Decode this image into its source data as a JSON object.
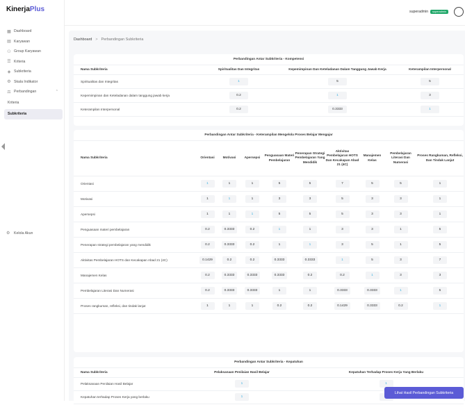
{
  "brand": {
    "name": "Kinerja",
    "accent": "Plus"
  },
  "sidebar": {
    "items": [
      {
        "label": "Dashboard",
        "icon": "grid-icon"
      },
      {
        "label": "Karyawan",
        "icon": "id-card-icon"
      },
      {
        "label": "Group Karyawan",
        "icon": "users-icon"
      },
      {
        "label": "Kriteria",
        "icon": "list-icon"
      },
      {
        "label": "Subkriteria",
        "icon": "layers-icon"
      },
      {
        "label": "Skala Indikator",
        "icon": "gear-icon"
      },
      {
        "label": "Perbandingan",
        "icon": "compare-icon"
      }
    ],
    "sub_items": [
      {
        "label": "Kriteria"
      },
      {
        "label": "Subkriteria"
      }
    ],
    "footer": {
      "label": "Kelola Akun"
    }
  },
  "topbar": {
    "username": "superadmin",
    "role": "superadmin"
  },
  "breadcrumb": {
    "home": "Dashboard",
    "separator": ">",
    "current": "Perbandingan Subkriteria"
  },
  "tables": [
    {
      "title": "Perbandingan Antar Subkriteria - Kompetensi",
      "col_header": "Nama Subkriteria",
      "columns": [
        "Spiritualitas Dan Integritas",
        "Kepemimpinan Dan Keteladanan Dalam Tanggung Jawab Kerja",
        "Keterampilan Interpersonal"
      ],
      "rows": [
        {
          "name": "Spiritualitas dan Integritas",
          "values": [
            "1",
            "5",
            "5"
          ]
        },
        {
          "name": "Kepemimpinan dan Keteladanan dalam tanggung jawab kerja",
          "values": [
            "0.2",
            "1",
            "3"
          ]
        },
        {
          "name": "Keterampilan Interpersonal",
          "values": [
            "0.2",
            "0.3333",
            "1"
          ]
        }
      ]
    },
    {
      "title": "Perbandingan Antar Subkriteria - Keterampilan Mengelola Proses Belajar Mengajar",
      "col_header": "Nama Subkriteria",
      "columns": [
        "Orientasi",
        "Motivasi",
        "Apersepsi",
        "Penguasaan Materi Pembelajaran",
        "Penerapan Strategi Pembelajaran Yang Mendidik",
        "Aktivitas Pembelajaran HOTS Dan Kecakapan Abad 21 (4C)",
        "Manajemen Kelas",
        "Pembelajaran Literasi Dan Numerasi",
        "Proses Rangkuman, Refleksi, Dan Tindak Lanjut"
      ],
      "rows": [
        {
          "name": "Orientasi",
          "values": [
            "1",
            "1",
            "1",
            "5",
            "5",
            "7",
            "5",
            "5",
            "1"
          ]
        },
        {
          "name": "Motivasi",
          "values": [
            "1",
            "1",
            "1",
            "3",
            "3",
            "5",
            "3",
            "3",
            "1"
          ]
        },
        {
          "name": "Apersepsi",
          "values": [
            "1",
            "1",
            "1",
            "5",
            "5",
            "5",
            "3",
            "3",
            "1"
          ]
        },
        {
          "name": "Penguasaan materi pembelajaran",
          "values": [
            "0.2",
            "0.3333",
            "0.2",
            "1",
            "1",
            "3",
            "3",
            "1",
            "5"
          ]
        },
        {
          "name": "Penerapan strategi pembelajaran yang mendidik",
          "values": [
            "0.2",
            "0.3333",
            "0.2",
            "1",
            "1",
            "3",
            "5",
            "1",
            "5"
          ]
        },
        {
          "name": "Aktivitas Pembelajaran HOTS dan Kecakapan Abad 21 (4C)",
          "values": [
            "0.1429",
            "0.2",
            "0.2",
            "0.3333",
            "0.3333",
            "1",
            "5",
            "3",
            "7"
          ]
        },
        {
          "name": "Manajemen Kelas",
          "values": [
            "0.2",
            "0.3333",
            "0.3333",
            "0.3333",
            "0.2",
            "0.2",
            "1",
            "3",
            "3"
          ]
        },
        {
          "name": "Pembelajaran Literasi Dan Numerasi",
          "values": [
            "0.2",
            "0.3333",
            "0.3333",
            "1",
            "1",
            "0.3333",
            "0.3333",
            "1",
            "5"
          ]
        },
        {
          "name": "Proses rangkuman, refleksi, dan tindak lanjut",
          "values": [
            "1",
            "1",
            "1",
            "0.2",
            "0.2",
            "0.1429",
            "0.3333",
            "0.2",
            "1"
          ]
        }
      ]
    },
    {
      "title": "Perbandingan Antar Subkriteria - Kepatuhan",
      "col_header": "Nama Subkriteria",
      "columns": [
        "Pelaksanaan Penilaian Hasil Belajar",
        "Kepatuhan Terhadap Proses Kerja Yang Berlaku"
      ],
      "rows": [
        {
          "name": "Pelaksanaan Penilaian Hasil Belajar",
          "values": [
            "1",
            "1"
          ]
        },
        {
          "name": "Kepatuhan terhadap Proses Kerja yang berlaku",
          "values": [
            "1",
            "1"
          ]
        }
      ]
    }
  ],
  "actions": {
    "result_button": "Lihat Hasil Perbandingan Subkriteria"
  },
  "colors": {
    "accent": "#5b5bd6",
    "badge": "#21a86a",
    "diagonal": "#3bb0e0"
  }
}
